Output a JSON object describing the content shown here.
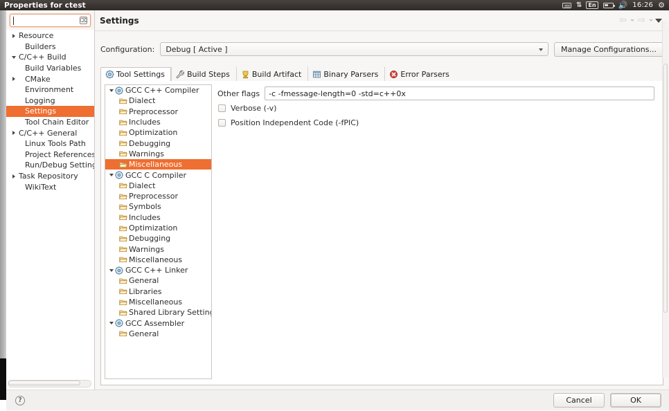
{
  "window": {
    "title": "Properties for ctest"
  },
  "tray": {
    "keyboard_icon": "keyboard-icon",
    "network_icon": "network-updown-icon",
    "language": "En",
    "battery_icon": "battery-icon",
    "volume_icon": "volume-icon",
    "clock": "16:26",
    "settings_icon": "gear-icon"
  },
  "search": {
    "value": "",
    "placeholder": "",
    "clear_icon": "clear-icon"
  },
  "sidebar": {
    "items": [
      {
        "label": "Resource",
        "indent": 0,
        "arrow": "right",
        "selected": false
      },
      {
        "label": "Builders",
        "indent": 1,
        "arrow": "none",
        "selected": false
      },
      {
        "label": "C/C++ Build",
        "indent": 0,
        "arrow": "down",
        "selected": false
      },
      {
        "label": "Build Variables",
        "indent": 1,
        "arrow": "none",
        "selected": false
      },
      {
        "label": "CMake",
        "indent": 1,
        "arrow": "right",
        "selected": false
      },
      {
        "label": "Environment",
        "indent": 1,
        "arrow": "none",
        "selected": false
      },
      {
        "label": "Logging",
        "indent": 1,
        "arrow": "none",
        "selected": false
      },
      {
        "label": "Settings",
        "indent": 1,
        "arrow": "none",
        "selected": true
      },
      {
        "label": "Tool Chain Editor",
        "indent": 1,
        "arrow": "none",
        "selected": false
      },
      {
        "label": "C/C++ General",
        "indent": 0,
        "arrow": "right",
        "selected": false
      },
      {
        "label": "Linux Tools Path",
        "indent": 1,
        "arrow": "none",
        "selected": false
      },
      {
        "label": "Project References",
        "indent": 1,
        "arrow": "none",
        "selected": false
      },
      {
        "label": "Run/Debug Settings",
        "indent": 1,
        "arrow": "none",
        "selected": false
      },
      {
        "label": "Task Repository",
        "indent": 0,
        "arrow": "right",
        "selected": false
      },
      {
        "label": "WikiText",
        "indent": 1,
        "arrow": "none",
        "selected": false
      }
    ]
  },
  "page": {
    "title": "Settings",
    "nav": {
      "back_icon": "back-arrow-icon",
      "back_menu_icon": "chevron-down-icon",
      "forward_icon": "forward-arrow-icon",
      "forward_menu_icon": "chevron-down-icon",
      "view_menu_icon": "view-menu-triangle-icon"
    }
  },
  "configuration": {
    "label": "Configuration:",
    "value": "Debug  [ Active ]",
    "dropdown_icon": "chevron-down-icon",
    "manage_button": "Manage Configurations..."
  },
  "tabs": [
    {
      "label": "Tool Settings",
      "icon": "tool-settings-icon",
      "active": true
    },
    {
      "label": "Build Steps",
      "icon": "wrench-icon",
      "active": false
    },
    {
      "label": "Build Artifact",
      "icon": "build-artifact-icon",
      "active": false
    },
    {
      "label": "Binary Parsers",
      "icon": "binary-parsers-icon",
      "active": false
    },
    {
      "label": "Error Parsers",
      "icon": "error-parsers-icon",
      "active": false
    }
  ],
  "tool_tree": [
    {
      "label": "GCC C++ Compiler",
      "level": 0,
      "icon": "tool-icon",
      "arrow": "down",
      "selected": false
    },
    {
      "label": "Dialect",
      "level": 1,
      "icon": "leaf-icon",
      "arrow": "none",
      "selected": false
    },
    {
      "label": "Preprocessor",
      "level": 1,
      "icon": "leaf-icon",
      "arrow": "none",
      "selected": false
    },
    {
      "label": "Includes",
      "level": 1,
      "icon": "leaf-icon",
      "arrow": "none",
      "selected": false
    },
    {
      "label": "Optimization",
      "level": 1,
      "icon": "leaf-icon",
      "arrow": "none",
      "selected": false
    },
    {
      "label": "Debugging",
      "level": 1,
      "icon": "leaf-icon",
      "arrow": "none",
      "selected": false
    },
    {
      "label": "Warnings",
      "level": 1,
      "icon": "leaf-icon",
      "arrow": "none",
      "selected": false
    },
    {
      "label": "Miscellaneous",
      "level": 1,
      "icon": "leaf-icon",
      "arrow": "none",
      "selected": true
    },
    {
      "label": "GCC C Compiler",
      "level": 0,
      "icon": "tool-icon",
      "arrow": "down",
      "selected": false
    },
    {
      "label": "Dialect",
      "level": 1,
      "icon": "leaf-icon",
      "arrow": "none",
      "selected": false
    },
    {
      "label": "Preprocessor",
      "level": 1,
      "icon": "leaf-icon",
      "arrow": "none",
      "selected": false
    },
    {
      "label": "Symbols",
      "level": 1,
      "icon": "leaf-icon",
      "arrow": "none",
      "selected": false
    },
    {
      "label": "Includes",
      "level": 1,
      "icon": "leaf-icon",
      "arrow": "none",
      "selected": false
    },
    {
      "label": "Optimization",
      "level": 1,
      "icon": "leaf-icon",
      "arrow": "none",
      "selected": false
    },
    {
      "label": "Debugging",
      "level": 1,
      "icon": "leaf-icon",
      "arrow": "none",
      "selected": false
    },
    {
      "label": "Warnings",
      "level": 1,
      "icon": "leaf-icon",
      "arrow": "none",
      "selected": false
    },
    {
      "label": "Miscellaneous",
      "level": 1,
      "icon": "leaf-icon",
      "arrow": "none",
      "selected": false
    },
    {
      "label": "GCC C++ Linker",
      "level": 0,
      "icon": "tool-icon",
      "arrow": "down",
      "selected": false
    },
    {
      "label": "General",
      "level": 1,
      "icon": "leaf-icon",
      "arrow": "none",
      "selected": false
    },
    {
      "label": "Libraries",
      "level": 1,
      "icon": "leaf-icon",
      "arrow": "none",
      "selected": false
    },
    {
      "label": "Miscellaneous",
      "level": 1,
      "icon": "leaf-icon",
      "arrow": "none",
      "selected": false
    },
    {
      "label": "Shared Library Settings",
      "level": 1,
      "icon": "leaf-icon",
      "arrow": "none",
      "selected": false
    },
    {
      "label": "GCC Assembler",
      "level": 0,
      "icon": "tool-icon",
      "arrow": "down",
      "selected": false
    },
    {
      "label": "General",
      "level": 1,
      "icon": "leaf-icon",
      "arrow": "none",
      "selected": false
    }
  ],
  "settings_panel": {
    "other_flags_label": "Other flags",
    "other_flags_value": "-c -fmessage-length=0 -std=c++0x",
    "checkboxes": [
      {
        "label": "Verbose (-v)",
        "checked": false
      },
      {
        "label": "Position Independent Code (-fPIC)",
        "checked": false
      }
    ]
  },
  "footer": {
    "help_icon": "help-icon",
    "help_glyph": "?",
    "cancel_label": "Cancel",
    "ok_label": "OK"
  },
  "colors": {
    "selection_orange": "#ef6e31",
    "titlebar": "#3c3633",
    "dialog_bg": "#f7f6f5"
  }
}
